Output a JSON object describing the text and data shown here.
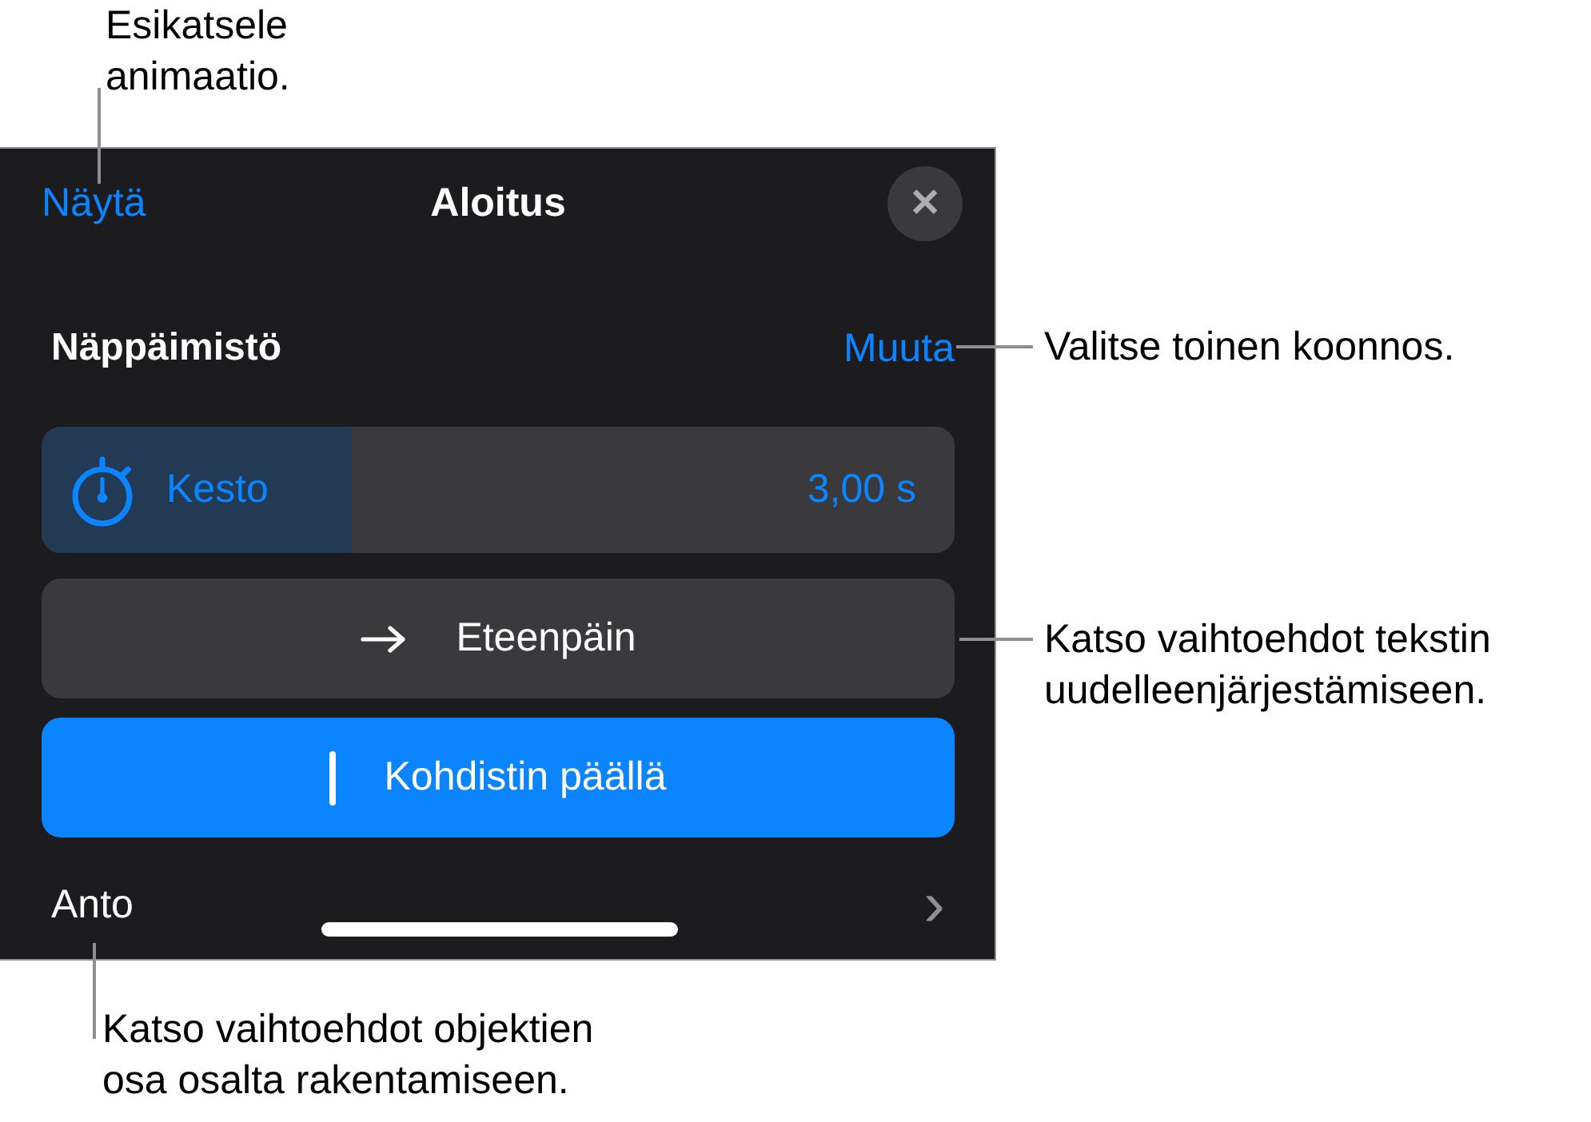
{
  "panel": {
    "preview_button": "Näytä",
    "title": "Aloitus",
    "close_button": "✕"
  },
  "build": {
    "label": "Näppäimistö",
    "change_button": "Muuta"
  },
  "duration": {
    "label": "Kesto",
    "level": 0.34,
    "reading": "3,00 s"
  },
  "options": [
    {
      "kind": "arrow",
      "label": "Eteenpäin",
      "selected": false
    },
    {
      "kind": "cursor",
      "label": "Kohdistin päällä",
      "selected": true
    }
  ],
  "footer": {
    "label": "Anto",
    "chevron": "›"
  },
  "callouts": [
    {
      "kind": "top",
      "text": "Esikatsele\nanimaatio."
    },
    {
      "kind": "right-build",
      "text": "Valitse toinen koonnos."
    },
    {
      "kind": "right-options",
      "text": "Katso vaihtoehdot tekstin\nuudelleenjärjestämiseen."
    },
    {
      "kind": "bottom",
      "text": "Katso vaihtoehdot objektien\nosa osalta rakentamiseen."
    }
  ]
}
